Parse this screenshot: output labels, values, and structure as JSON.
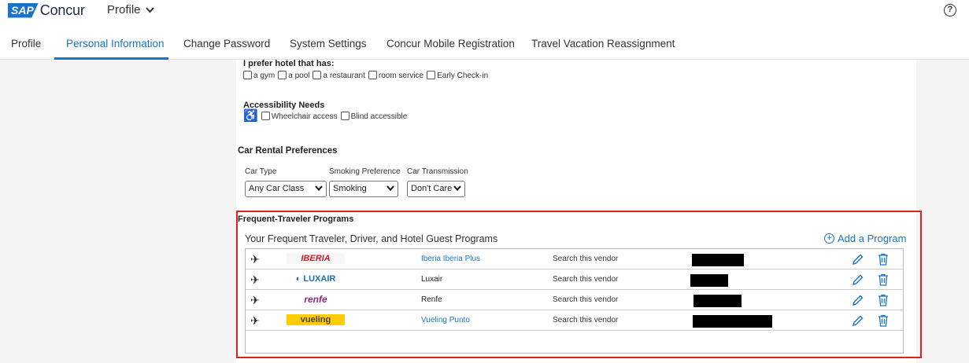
{
  "header": {
    "sap_label": "SAP",
    "concur_label": "Concur",
    "profile_menu": "Profile",
    "help": "?"
  },
  "tabs": [
    {
      "label": "Profile",
      "active": false
    },
    {
      "label": "Personal Information",
      "active": true
    },
    {
      "label": "Change Password",
      "active": false
    },
    {
      "label": "System Settings",
      "active": false
    },
    {
      "label": "Concur Mobile Registration",
      "active": false
    },
    {
      "label": "Travel Vacation Reassignment",
      "active": false
    }
  ],
  "hotel": {
    "title": "I prefer hotel that has:",
    "options": [
      "a gym",
      "a pool",
      "a restaurant",
      "room service",
      "Early Check-in"
    ]
  },
  "accessibility": {
    "title": "Accessibility Needs",
    "options": [
      "Wheelchair access",
      "Blind accessible"
    ]
  },
  "car": {
    "title": "Car Rental Preferences",
    "type_label": "Car Type",
    "type_value": "Any Car Class",
    "smoking_label": "Smoking Preference",
    "smoking_value": "Smoking",
    "transmission_label": "Car Transmission",
    "transmission_value": "Don't Care"
  },
  "ftp": {
    "title": "Frequent-Traveler Programs",
    "subtitle": "Your Frequent Traveler, Driver, and Hotel Guest Programs",
    "add_label": "Add a Program",
    "rows": [
      {
        "logo": "IBERIA",
        "program": "Iberia Iberia Plus",
        "link": true,
        "search": "Search this vendor"
      },
      {
        "logo": "LUXAIR",
        "program": "Luxair",
        "link": false,
        "search": "Search this vendor"
      },
      {
        "logo": "renfe",
        "program": "Renfe",
        "link": false,
        "search": "Search this vendor"
      },
      {
        "logo": "vueling",
        "program": "Vueling Punto",
        "link": true,
        "search": "Search this vendor"
      }
    ]
  },
  "colors": {
    "accent": "#1a73c9",
    "highlight_border": "#e0201c",
    "iberia": "#d7192d",
    "luxair": "#1c6fb5",
    "renfe": "#8a2a7a",
    "vueling": "#ffcc00"
  }
}
